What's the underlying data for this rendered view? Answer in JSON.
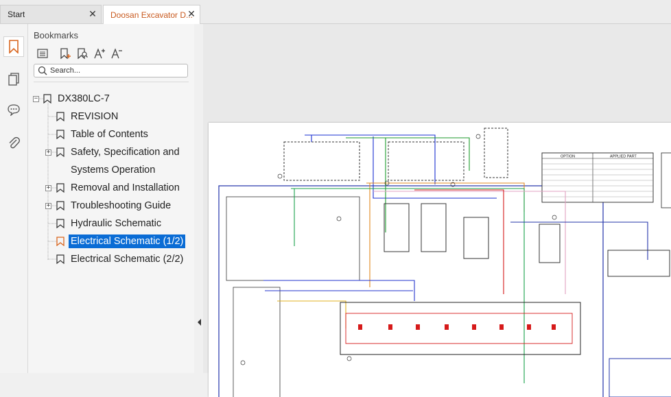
{
  "tabs": [
    {
      "label": "Start",
      "active": false
    },
    {
      "label": "Doosan Excavator D...",
      "active": true
    }
  ],
  "rail": {
    "items": [
      "bookmarks-icon",
      "pages-icon",
      "comments-icon",
      "attachments-icon"
    ]
  },
  "bookmarks": {
    "title": "Bookmarks",
    "toolbar": [
      "options-list-icon",
      "add-bookmark-icon",
      "find-bookmark-icon",
      "increase-text-icon",
      "decrease-text-icon"
    ],
    "search_placeholder": "Search...",
    "tree": {
      "root": "DX380LC-7",
      "items": [
        {
          "label": "REVISION"
        },
        {
          "label": "Table of Contents"
        },
        {
          "label_line1": "Safety, Specification and",
          "label_line2": "Systems Operation"
        },
        {
          "label": "Removal and Installation"
        },
        {
          "label": "Troubleshooting Guide"
        },
        {
          "label": "Hydraulic Schematic"
        },
        {
          "label": "Electrical Schematic (1/2)",
          "selected": true
        },
        {
          "label": "Electrical Schematic (2/2)"
        }
      ]
    }
  },
  "document": {
    "legend_header": [
      "OPTION",
      "APPLIED PART"
    ]
  },
  "colors": {
    "accent": "#c8591e",
    "selection": "#0a6cd5"
  }
}
